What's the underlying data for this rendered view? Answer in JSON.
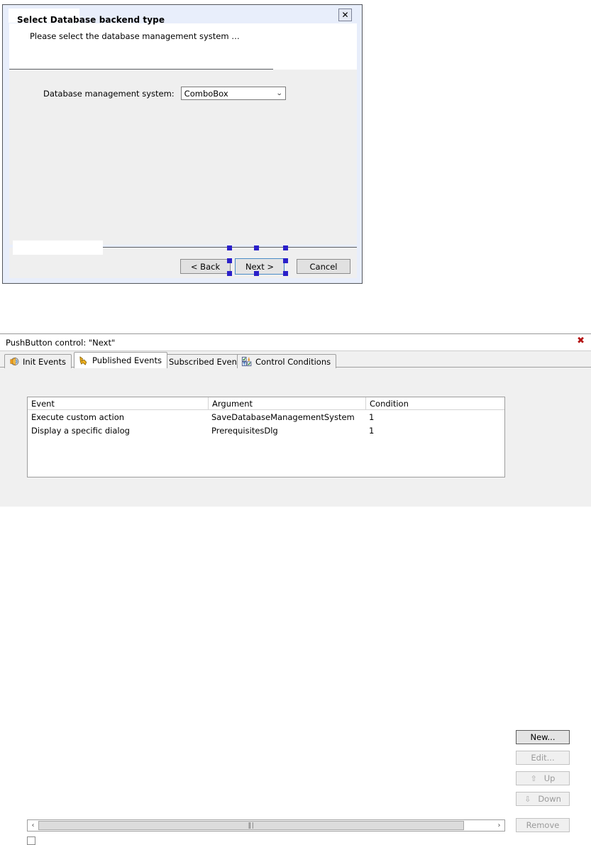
{
  "dialog": {
    "title_placeholder": "",
    "close_label": "✕",
    "header_title": "Select Database backend type",
    "header_subtitle": "Please select the database management system …",
    "dbms_label": "Database management system:",
    "dbms_value": "ComboBox",
    "dbms_arrow": "⌄",
    "buttons": {
      "back": "< Back",
      "next": "Next >",
      "cancel": "Cancel"
    },
    "selected_control": "Next >"
  },
  "panel": {
    "title": "PushButton control: \"Next\"",
    "close_label": "✖",
    "tabs": [
      {
        "label": "Init Events",
        "icon": "init-events-icon",
        "active": false
      },
      {
        "label": "Published Events",
        "icon": "published-events-icon",
        "active": true
      },
      {
        "label": "Subscribed Events",
        "icon": "subscribed-events-icon",
        "active": false
      },
      {
        "label": "Control Conditions",
        "icon": "control-conditions-icon",
        "active": false
      }
    ],
    "table": {
      "columns": [
        "Event",
        "Argument",
        "Condition"
      ],
      "rows": [
        [
          "Execute custom action",
          "SaveDatabaseManagementSystem",
          "1"
        ],
        [
          "Display a specific dialog",
          "PrerequisitesDlg",
          "1"
        ]
      ]
    },
    "scrollbar": {
      "left_arrow": "‹",
      "right_arrow": "›",
      "grip": "‖∣"
    },
    "side_buttons": [
      {
        "label": "New...",
        "arrow": "",
        "enabled": true
      },
      {
        "label": "Edit...",
        "arrow": "",
        "enabled": false
      },
      {
        "label": "Up",
        "arrow": "⇧",
        "enabled": false
      },
      {
        "label": "Down",
        "arrow": "⇩",
        "enabled": false
      },
      {
        "label": "Remove",
        "arrow": "",
        "enabled": false
      }
    ]
  },
  "colors": {
    "dialog_chrome": "#e8eefb",
    "dialog_body": "#efefef",
    "selection_handle": "#2b20c9",
    "panel_close_red": "#b41414",
    "selected_button_border": "#4a8cc7"
  }
}
